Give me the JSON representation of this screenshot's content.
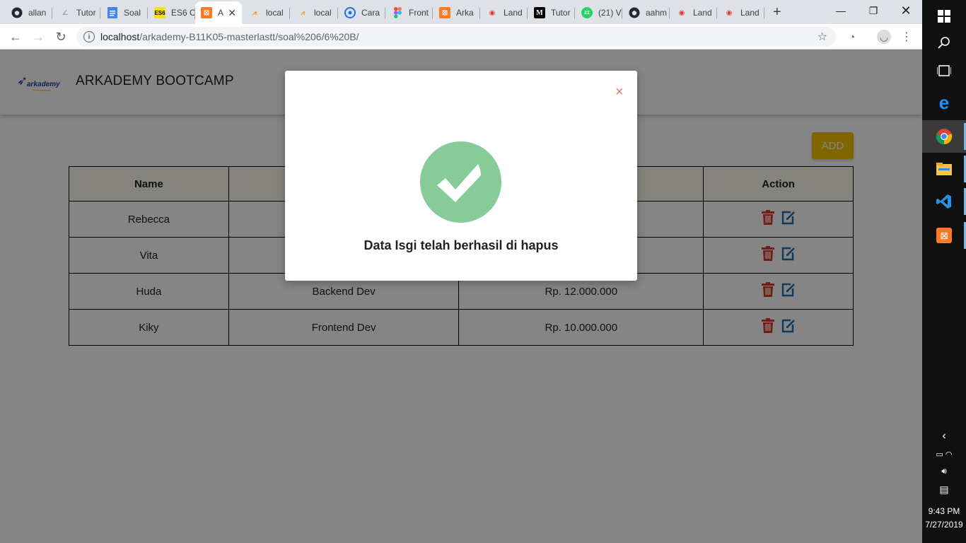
{
  "browser": {
    "tabs": [
      {
        "title": "allan",
        "icon": "github-icon",
        "color": "#24292e"
      },
      {
        "title": "Tutor",
        "icon": "page-icon",
        "color": "#9aa0a6"
      },
      {
        "title": "Soal",
        "icon": "google-docs-icon",
        "color": "#4285f4"
      },
      {
        "title": "ES6 C",
        "icon": "es6-icon",
        "color": "#000000"
      },
      {
        "title": "A",
        "icon": "xampp-icon",
        "color": "#fb7a24"
      },
      {
        "title": "local",
        "icon": "phpmyadmin-icon",
        "color": "#f29111"
      },
      {
        "title": "local",
        "icon": "phpmyadmin-icon",
        "color": "#f29111"
      },
      {
        "title": "Cara",
        "icon": "site-icon",
        "color": "#1a73e8"
      },
      {
        "title": "Front",
        "icon": "figma-icon",
        "color": "#f24e1e"
      },
      {
        "title": "Arka",
        "icon": "xampp-icon",
        "color": "#fb7a24"
      },
      {
        "title": "Land",
        "icon": "wifi-icon",
        "color": "#e53935"
      },
      {
        "title": "Tutor",
        "icon": "medium-icon",
        "color": "#000000"
      },
      {
        "title": "(21) V",
        "icon": "whatsapp-icon",
        "color": "#25d366"
      },
      {
        "title": "aahm",
        "icon": "github-icon",
        "color": "#24292e"
      },
      {
        "title": "Land",
        "icon": "wifi-icon",
        "color": "#e53935"
      },
      {
        "title": "Land",
        "icon": "wifi-icon",
        "color": "#e53935"
      }
    ],
    "url_host": "localhost",
    "url_path": "/arkademy-B11K05-masterlastt/soal%206/6%20B/"
  },
  "site": {
    "brand": "ARKADEMY BOOTCAMP",
    "logo_text": "arkademy",
    "logo_tagline": "Your Academy",
    "add_label": "ADD"
  },
  "table": {
    "headers": [
      "Name",
      "",
      "",
      "Action"
    ],
    "rows": [
      {
        "name": "Rebecca",
        "work": "",
        "salary": ""
      },
      {
        "name": "Vita",
        "work": "",
        "salary": ""
      },
      {
        "name": "Huda",
        "work": "Backend Dev",
        "salary": "Rp. 12.000.000"
      },
      {
        "name": "Kiky",
        "work": "Frontend Dev",
        "salary": "Rp. 10.000.000"
      }
    ]
  },
  "modal": {
    "close": "×",
    "message": "Data Isgi telah berhasil di hapus"
  },
  "taskbar": {
    "time": "9:43 PM",
    "date": "7/27/2019"
  },
  "colors": {
    "add_button": "#f5c400",
    "delete_icon": "#d63a2c",
    "edit_icon": "#1e6fb5",
    "success_circle": "#87cb99",
    "close_x": "#f27474"
  }
}
